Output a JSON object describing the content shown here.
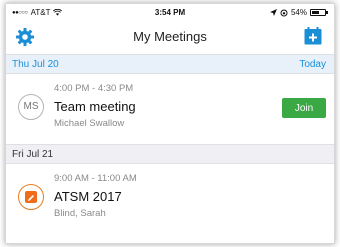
{
  "status_bar": {
    "signal": "●●○○○",
    "carrier": "AT&T",
    "time": "3:54 PM",
    "battery": "54%",
    "battery_level": 0.54
  },
  "nav": {
    "title": "My Meetings",
    "settings_icon": "gear-icon",
    "add_icon": "calendar-add-icon"
  },
  "sections": [
    {
      "date": "Thu Jul 20",
      "action_label": "Today",
      "meetings": [
        {
          "avatar_initials": "MS",
          "time": "4:00 PM - 4:30 PM",
          "title": "Team meeting",
          "organizer": "Michael Swallow",
          "action_label": "Join"
        }
      ]
    },
    {
      "date": "Fri Jul 21",
      "meetings": [
        {
          "avatar_icon": "calendar-event-icon",
          "time": "9:00 AM - 11:00 AM",
          "title": "ATSM 2017",
          "organizer": "Blind, Sarah"
        }
      ]
    }
  ],
  "colors": {
    "accent": "#1a8fd6",
    "join_green": "#3aa843",
    "event_orange": "#ef6c1b"
  }
}
